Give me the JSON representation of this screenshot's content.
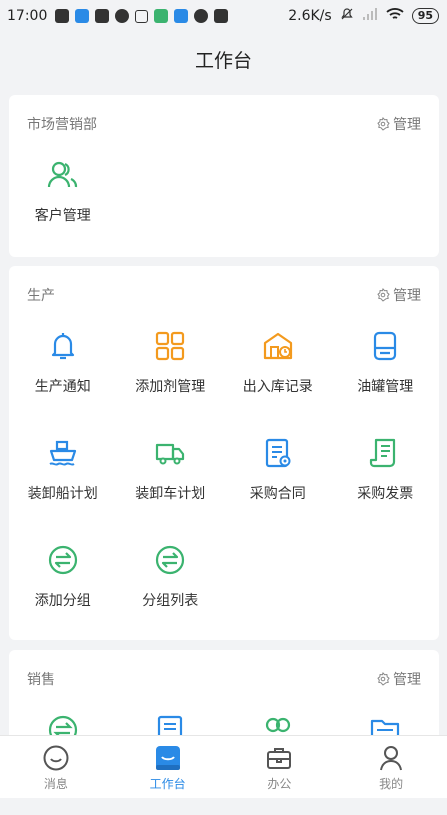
{
  "statusbar": {
    "time": "17:00",
    "speed": "2.6K/s",
    "battery": "95"
  },
  "header": {
    "title": "工作台"
  },
  "sections": [
    {
      "title": "市场营销部",
      "manage": "管理",
      "items": [
        {
          "label": "客户管理",
          "icon": "customers-icon"
        }
      ]
    },
    {
      "title": "生产",
      "manage": "管理",
      "items": [
        {
          "label": "生产通知",
          "icon": "bell-icon"
        },
        {
          "label": "添加剂管理",
          "icon": "grid-apps-icon"
        },
        {
          "label": "出入库记录",
          "icon": "warehouse-clock-icon"
        },
        {
          "label": "油罐管理",
          "icon": "tank-icon"
        },
        {
          "label": "装卸船计划",
          "icon": "ship-icon"
        },
        {
          "label": "装卸车计划",
          "icon": "truck-icon"
        },
        {
          "label": "采购合同",
          "icon": "contract-icon"
        },
        {
          "label": "采购发票",
          "icon": "invoice-icon"
        },
        {
          "label": "添加分组",
          "icon": "exchange-icon"
        },
        {
          "label": "分组列表",
          "icon": "exchange-icon"
        }
      ]
    },
    {
      "title": "销售",
      "manage": "管理",
      "items": [
        {
          "label": "",
          "icon": "exchange-icon"
        },
        {
          "label": "",
          "icon": "document-icon"
        },
        {
          "label": "",
          "icon": "people-icon"
        },
        {
          "label": "",
          "icon": "folder-icon"
        }
      ]
    }
  ],
  "tabs": [
    {
      "label": "消息",
      "icon": "message-icon"
    },
    {
      "label": "工作台",
      "icon": "workbench-icon",
      "active": true
    },
    {
      "label": "办公",
      "icon": "briefcase-icon"
    },
    {
      "label": "我的",
      "icon": "user-icon"
    }
  ],
  "colors": {
    "green": "#3bb36f",
    "blue": "#2a8ae6",
    "orange": "#f39a1e"
  }
}
